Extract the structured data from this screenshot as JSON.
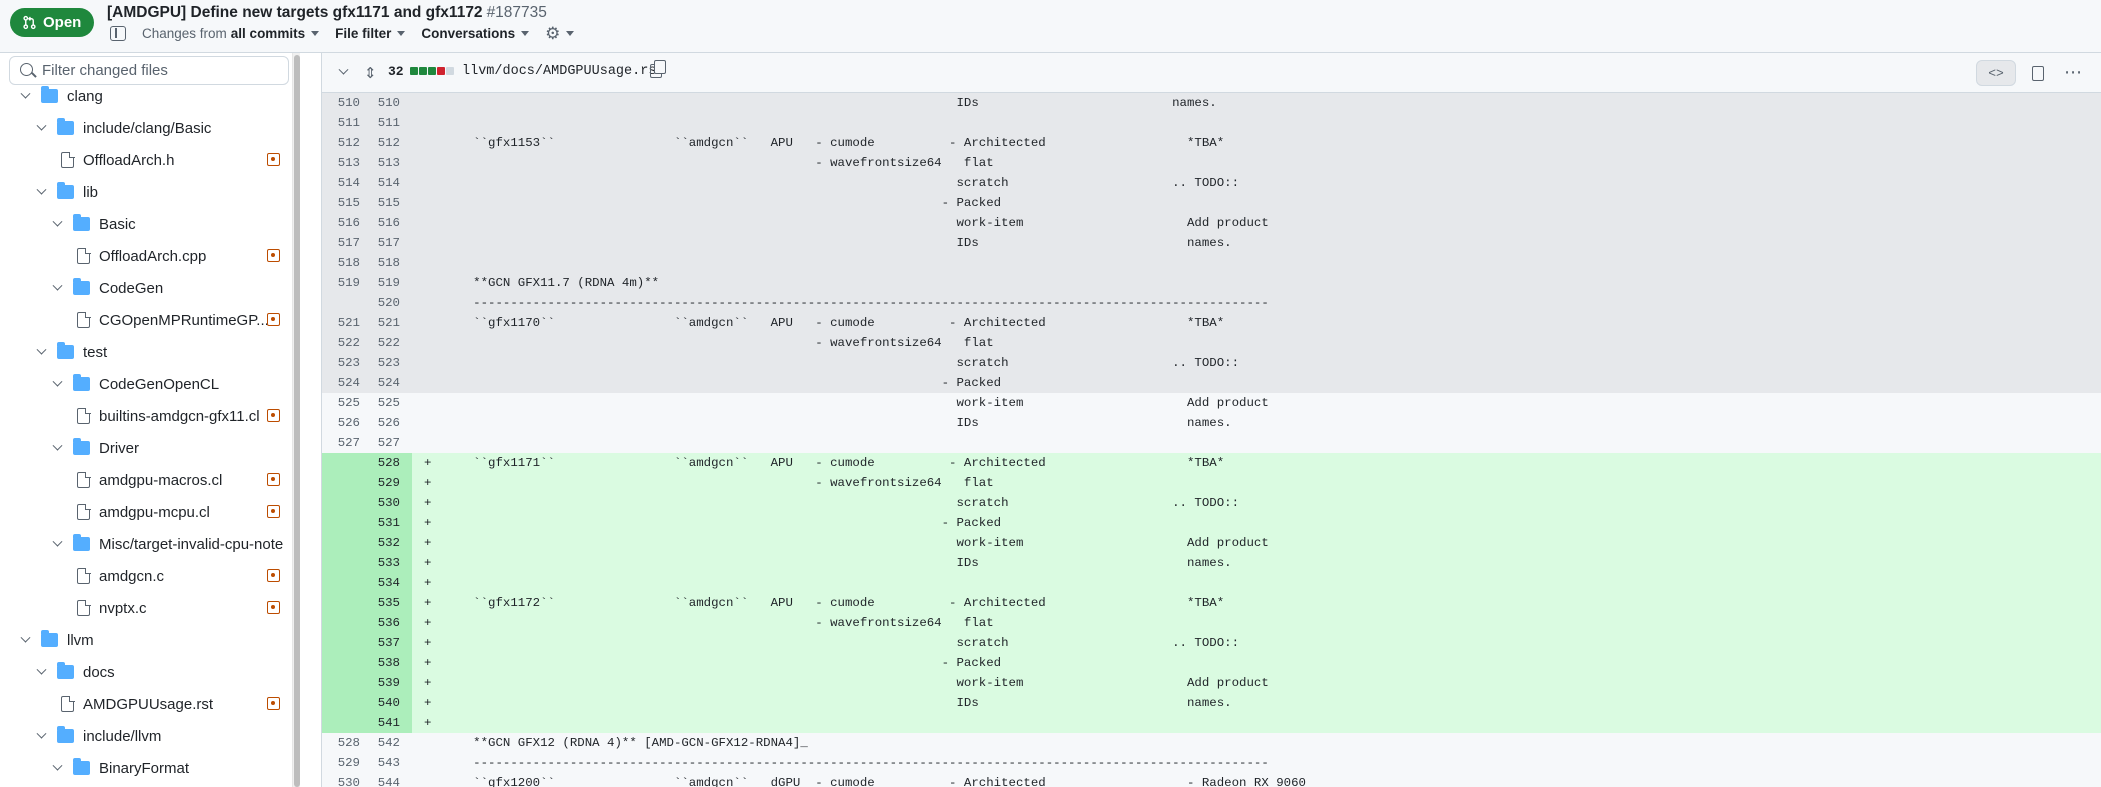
{
  "header": {
    "status": "Open",
    "title": "[AMDGPU] Define new targets gfx1171 and gfx1172",
    "number": "#187735",
    "changes_prefix": "Changes from",
    "changes_value": "all commits",
    "file_filter": "File filter",
    "conversations": "Conversations"
  },
  "sidebar": {
    "filter_placeholder": "Filter changed files",
    "tree": [
      {
        "type": "folder",
        "label": "clang",
        "depth": 0
      },
      {
        "type": "folder",
        "label": "include/clang/Basic",
        "depth": 1
      },
      {
        "type": "file",
        "label": "OffloadArch.h",
        "depth": 2,
        "modified": true
      },
      {
        "type": "folder",
        "label": "lib",
        "depth": 1
      },
      {
        "type": "folder",
        "label": "Basic",
        "depth": 2
      },
      {
        "type": "file",
        "label": "OffloadArch.cpp",
        "depth": 3,
        "modified": true
      },
      {
        "type": "folder",
        "label": "CodeGen",
        "depth": 2
      },
      {
        "type": "file",
        "label": "CGOpenMPRuntimeGP...",
        "depth": 3,
        "modified": true
      },
      {
        "type": "folder",
        "label": "test",
        "depth": 1
      },
      {
        "type": "folder",
        "label": "CodeGenOpenCL",
        "depth": 2
      },
      {
        "type": "file",
        "label": "builtins-amdgcn-gfx11.cl",
        "depth": 3,
        "modified": true
      },
      {
        "type": "folder",
        "label": "Driver",
        "depth": 2
      },
      {
        "type": "file",
        "label": "amdgpu-macros.cl",
        "depth": 3,
        "modified": true
      },
      {
        "type": "file",
        "label": "amdgpu-mcpu.cl",
        "depth": 3,
        "modified": true
      },
      {
        "type": "folder",
        "label": "Misc/target-invalid-cpu-note",
        "depth": 2
      },
      {
        "type": "file",
        "label": "amdgcn.c",
        "depth": 3,
        "modified": true
      },
      {
        "type": "file",
        "label": "nvptx.c",
        "depth": 3,
        "modified": true
      },
      {
        "type": "folder",
        "label": "llvm",
        "depth": 0
      },
      {
        "type": "folder",
        "label": "docs",
        "depth": 1
      },
      {
        "type": "file",
        "label": "AMDGPUUsage.rst",
        "depth": 2,
        "modified": true
      },
      {
        "type": "folder",
        "label": "include/llvm",
        "depth": 1
      },
      {
        "type": "folder",
        "label": "BinaryFormat",
        "depth": 2
      }
    ]
  },
  "diff": {
    "changed_count": "32",
    "path": "llvm/docs/AMDGPUUsage.rst",
    "colors": {
      "add": "#1f883d",
      "del": "#cf222e",
      "neutral": "#d1d9e0"
    },
    "lines": [
      {
        "kind": "hidden-ctx",
        "old": "510",
        "new": "510",
        "sign": "",
        "code": "                                                                      IDs                          names."
      },
      {
        "kind": "hidden-ctx",
        "old": "511",
        "new": "511",
        "sign": "",
        "code": ""
      },
      {
        "kind": "hidden-ctx",
        "old": "512",
        "new": "512",
        "sign": "",
        "code": "     ``gfx1153``                ``amdgcn``   APU   - cumode          - Architected                   *TBA*"
      },
      {
        "kind": "hidden-ctx",
        "old": "513",
        "new": "513",
        "sign": "",
        "code": "                                                   - wavefrontsize64   flat"
      },
      {
        "kind": "hidden-ctx",
        "old": "514",
        "new": "514",
        "sign": "",
        "code": "                                                                      scratch                      .. TODO::"
      },
      {
        "kind": "hidden-ctx",
        "old": "515",
        "new": "515",
        "sign": "",
        "code": "                                                                    - Packed"
      },
      {
        "kind": "hidden-ctx",
        "old": "516",
        "new": "516",
        "sign": "",
        "code": "                                                                      work-item                      Add product"
      },
      {
        "kind": "hidden-ctx",
        "old": "517",
        "new": "517",
        "sign": "",
        "code": "                                                                      IDs                            names."
      },
      {
        "kind": "hidden-ctx",
        "old": "518",
        "new": "518",
        "sign": "",
        "code": ""
      },
      {
        "kind": "hidden-ctx",
        "old": "519",
        "new": "519",
        "sign": "",
        "code": "     **GCN GFX11.7 (RDNA 4m)**"
      },
      {
        "kind": "hidden-ctx",
        "old": "",
        "new": "520",
        "sign": "",
        "code": "     -----------------------------------------------------------------------------------------------------------"
      },
      {
        "kind": "hidden-ctx",
        "old": "521",
        "new": "521",
        "sign": "",
        "code": "     ``gfx1170``                ``amdgcn``   APU   - cumode          - Architected                   *TBA*"
      },
      {
        "kind": "hidden-ctx",
        "old": "522",
        "new": "522",
        "sign": "",
        "code": "                                                   - wavefrontsize64   flat"
      },
      {
        "kind": "hidden-ctx",
        "old": "523",
        "new": "523",
        "sign": "",
        "code": "                                                                      scratch                      .. TODO::"
      },
      {
        "kind": "hidden-ctx",
        "old": "524",
        "new": "524",
        "sign": "",
        "code": "                                                                    - Packed"
      },
      {
        "kind": "ctx",
        "old": "525",
        "new": "525",
        "sign": "",
        "code": "                                                                      work-item                      Add product"
      },
      {
        "kind": "ctx",
        "old": "526",
        "new": "526",
        "sign": "",
        "code": "                                                                      IDs                            names."
      },
      {
        "kind": "ctx",
        "old": "527",
        "new": "527",
        "sign": "",
        "code": ""
      },
      {
        "kind": "add",
        "old": "",
        "new": "528",
        "sign": "+",
        "code": "     ``gfx1171``                ``amdgcn``   APU   - cumode          - Architected                   *TBA*"
      },
      {
        "kind": "add",
        "old": "",
        "new": "529",
        "sign": "+",
        "code": "                                                   - wavefrontsize64   flat"
      },
      {
        "kind": "add",
        "old": "",
        "new": "530",
        "sign": "+",
        "code": "                                                                      scratch                      .. TODO::"
      },
      {
        "kind": "add",
        "old": "",
        "new": "531",
        "sign": "+",
        "code": "                                                                    - Packed"
      },
      {
        "kind": "add",
        "old": "",
        "new": "532",
        "sign": "+",
        "code": "                                                                      work-item                      Add product"
      },
      {
        "kind": "add",
        "old": "",
        "new": "533",
        "sign": "+",
        "code": "                                                                      IDs                            names."
      },
      {
        "kind": "add",
        "old": "",
        "new": "534",
        "sign": "+",
        "code": ""
      },
      {
        "kind": "add",
        "old": "",
        "new": "535",
        "sign": "+",
        "code": "     ``gfx1172``                ``amdgcn``   APU   - cumode          - Architected                   *TBA*"
      },
      {
        "kind": "add",
        "old": "",
        "new": "536",
        "sign": "+",
        "code": "                                                   - wavefrontsize64   flat"
      },
      {
        "kind": "add",
        "old": "",
        "new": "537",
        "sign": "+",
        "code": "                                                                      scratch                      .. TODO::"
      },
      {
        "kind": "add",
        "old": "",
        "new": "538",
        "sign": "+",
        "code": "                                                                    - Packed"
      },
      {
        "kind": "add",
        "old": "",
        "new": "539",
        "sign": "+",
        "code": "                                                                      work-item                      Add product"
      },
      {
        "kind": "add",
        "old": "",
        "new": "540",
        "sign": "+",
        "code": "                                                                      IDs                            names."
      },
      {
        "kind": "add",
        "old": "",
        "new": "541",
        "sign": "+",
        "code": ""
      },
      {
        "kind": "ctx",
        "old": "528",
        "new": "542",
        "sign": "",
        "code": "     **GCN GFX12 (RDNA 4)** [AMD-GCN-GFX12-RDNA4]_"
      },
      {
        "kind": "ctx",
        "old": "529",
        "new": "543",
        "sign": "",
        "code": "     -----------------------------------------------------------------------------------------------------------"
      },
      {
        "kind": "ctx",
        "old": "530",
        "new": "544",
        "sign": "",
        "code": "     ``gfx1200``                ``amdgcn``   dGPU  - cumode          - Architected                   - Radeon RX 9060"
      }
    ]
  }
}
